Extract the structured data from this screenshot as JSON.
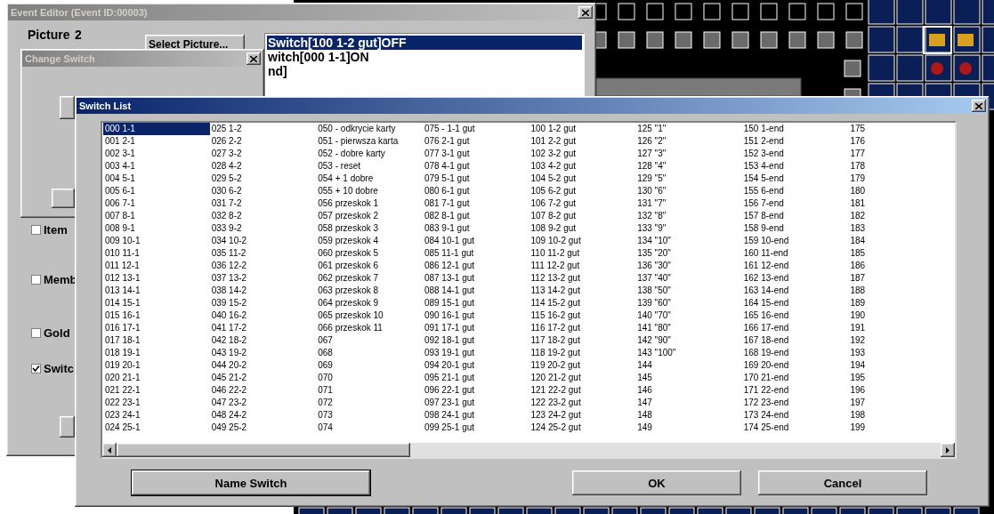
{
  "event_editor": {
    "title": "Event Editor (Event ID:00003)",
    "picture_label": "Picture",
    "picture_value": "2",
    "select_picture_button": "Select Picture...",
    "commands": [
      {
        "label": "Switch[100 1-2 gut]OFF",
        "selected": true
      },
      {
        "label": "witch[000 1-1]ON",
        "selected": false
      },
      {
        "label": "nd]",
        "selected": false
      }
    ],
    "checkboxes": [
      {
        "label": "Item",
        "checked": false
      },
      {
        "label": "Memb",
        "checked": false
      },
      {
        "label": "Gold",
        "checked": false
      },
      {
        "label": "Switc",
        "checked": true
      }
    ]
  },
  "change_switch": {
    "title": "Change Switch"
  },
  "switch_list": {
    "title": "Switch List",
    "columns": [
      {
        "items": [
          {
            "label": "000 1-1",
            "selected": true
          },
          {
            "label": "001 2-1",
            "selected": false
          },
          {
            "label": "002 3-1",
            "selected": false
          },
          {
            "label": "003 4-1",
            "selected": false
          },
          {
            "label": "004 5-1",
            "selected": false
          },
          {
            "label": "005 6-1",
            "selected": false
          },
          {
            "label": "006 7-1",
            "selected": false
          },
          {
            "label": "007 8-1",
            "selected": false
          },
          {
            "label": "008 9-1",
            "selected": false
          },
          {
            "label": "009 10-1",
            "selected": false
          },
          {
            "label": "010 11-1",
            "selected": false
          },
          {
            "label": "011 12-1",
            "selected": false
          },
          {
            "label": "012 13-1",
            "selected": false
          },
          {
            "label": "013 14-1",
            "selected": false
          },
          {
            "label": "014 15-1",
            "selected": false
          },
          {
            "label": "015 16-1",
            "selected": false
          },
          {
            "label": "016 17-1",
            "selected": false
          },
          {
            "label": "017 18-1",
            "selected": false
          },
          {
            "label": "018 19-1",
            "selected": false
          },
          {
            "label": "019 20-1",
            "selected": false
          },
          {
            "label": "020 21-1",
            "selected": false
          },
          {
            "label": "021 22-1",
            "selected": false
          },
          {
            "label": "022 23-1",
            "selected": false
          },
          {
            "label": "023 24-1",
            "selected": false
          },
          {
            "label": "024 25-1",
            "selected": false
          }
        ]
      },
      {
        "items": [
          {
            "label": "025 1-2",
            "selected": false
          },
          {
            "label": "026 2-2",
            "selected": false
          },
          {
            "label": "027 3-2",
            "selected": false
          },
          {
            "label": "028 4-2",
            "selected": false
          },
          {
            "label": "029 5-2",
            "selected": false
          },
          {
            "label": "030 6-2",
            "selected": false
          },
          {
            "label": "031 7-2",
            "selected": false
          },
          {
            "label": "032 8-2",
            "selected": false
          },
          {
            "label": "033 9-2",
            "selected": false
          },
          {
            "label": "034 10-2",
            "selected": false
          },
          {
            "label": "035 11-2",
            "selected": false
          },
          {
            "label": "036 12-2",
            "selected": false
          },
          {
            "label": "037 13-2",
            "selected": false
          },
          {
            "label": "038 14-2",
            "selected": false
          },
          {
            "label": "039 15-2",
            "selected": false
          },
          {
            "label": "040 16-2",
            "selected": false
          },
          {
            "label": "041 17-2",
            "selected": false
          },
          {
            "label": "042 18-2",
            "selected": false
          },
          {
            "label": "043 19-2",
            "selected": false
          },
          {
            "label": "044 20-2",
            "selected": false
          },
          {
            "label": "045 21-2",
            "selected": false
          },
          {
            "label": "046 22-2",
            "selected": false
          },
          {
            "label": "047 23-2",
            "selected": false
          },
          {
            "label": "048 24-2",
            "selected": false
          },
          {
            "label": "049 25-2",
            "selected": false
          }
        ]
      },
      {
        "items": [
          {
            "label": "050 - odkrycie karty",
            "selected": false
          },
          {
            "label": "051 - pierwsza karta",
            "selected": false
          },
          {
            "label": "052 - dobre karty",
            "selected": false
          },
          {
            "label": "053 - reset",
            "selected": false
          },
          {
            "label": "054 + 1 dobre",
            "selected": false
          },
          {
            "label": "055 + 10 dobre",
            "selected": false
          },
          {
            "label": "056 przeskok 1",
            "selected": false
          },
          {
            "label": "057 przeskok 2",
            "selected": false
          },
          {
            "label": "058 przeskok 3",
            "selected": false
          },
          {
            "label": "059 przeskok 4",
            "selected": false
          },
          {
            "label": "060 przeskok 5",
            "selected": false
          },
          {
            "label": "061 przeskok 6",
            "selected": false
          },
          {
            "label": "062 przeskok 7",
            "selected": false
          },
          {
            "label": "063 przeskok 8",
            "selected": false
          },
          {
            "label": "064 przeskok 9",
            "selected": false
          },
          {
            "label": "065 przeskok 10",
            "selected": false
          },
          {
            "label": "066 przeskok 11",
            "selected": false
          },
          {
            "label": "067",
            "selected": false
          },
          {
            "label": "068",
            "selected": false
          },
          {
            "label": "069",
            "selected": false
          },
          {
            "label": "070",
            "selected": false
          },
          {
            "label": "071",
            "selected": false
          },
          {
            "label": "072",
            "selected": false
          },
          {
            "label": "073",
            "selected": false
          },
          {
            "label": "074",
            "selected": false
          }
        ]
      },
      {
        "items": [
          {
            "label": "075 - 1-1 gut",
            "selected": false
          },
          {
            "label": "076 2-1 gut",
            "selected": false
          },
          {
            "label": "077 3-1 gut",
            "selected": false
          },
          {
            "label": "078 4-1 gut",
            "selected": false
          },
          {
            "label": "079 5-1 gut",
            "selected": false
          },
          {
            "label": "080 6-1 gut",
            "selected": false
          },
          {
            "label": "081 7-1 gut",
            "selected": false
          },
          {
            "label": "082 8-1 gut",
            "selected": false
          },
          {
            "label": "083 9-1 gut",
            "selected": false
          },
          {
            "label": "084 10-1 gut",
            "selected": false
          },
          {
            "label": "085 11-1 gut",
            "selected": false
          },
          {
            "label": "086 12-1 gut",
            "selected": false
          },
          {
            "label": "087 13-1 gut",
            "selected": false
          },
          {
            "label": "088 14-1 gut",
            "selected": false
          },
          {
            "label": "089 15-1 gut",
            "selected": false
          },
          {
            "label": "090 16-1 gut",
            "selected": false
          },
          {
            "label": "091 17-1 gut",
            "selected": false
          },
          {
            "label": "092 18-1 gut",
            "selected": false
          },
          {
            "label": "093 19-1 gut",
            "selected": false
          },
          {
            "label": "094 20-1 gut",
            "selected": false
          },
          {
            "label": "095 21-1 gut",
            "selected": false
          },
          {
            "label": "096 22-1 gut",
            "selected": false
          },
          {
            "label": "097 23-1 gut",
            "selected": false
          },
          {
            "label": "098 24-1 gut",
            "selected": false
          },
          {
            "label": "099 25-1 gut",
            "selected": false
          }
        ]
      },
      {
        "items": [
          {
            "label": "100 1-2 gut",
            "selected": false
          },
          {
            "label": "101 2-2 gut",
            "selected": false
          },
          {
            "label": "102 3-2 gut",
            "selected": false
          },
          {
            "label": "103 4-2 gut",
            "selected": false
          },
          {
            "label": "104 5-2 gut",
            "selected": false
          },
          {
            "label": "105 6-2 gut",
            "selected": false
          },
          {
            "label": "106 7-2 gut",
            "selected": false
          },
          {
            "label": "107 8-2 gut",
            "selected": false
          },
          {
            "label": "108 9-2 gut",
            "selected": false
          },
          {
            "label": "109 10-2 gut",
            "selected": false
          },
          {
            "label": "110 11-2 gut",
            "selected": false
          },
          {
            "label": "111 12-2 gut",
            "selected": false
          },
          {
            "label": "112 13-2 gut",
            "selected": false
          },
          {
            "label": "113 14-2 gut",
            "selected": false
          },
          {
            "label": "114 15-2 gut",
            "selected": false
          },
          {
            "label": "115 16-2 gut",
            "selected": false
          },
          {
            "label": "116 17-2 gut",
            "selected": false
          },
          {
            "label": "117 18-2 gut",
            "selected": false
          },
          {
            "label": "118 19-2 gut",
            "selected": false
          },
          {
            "label": "119 20-2 gut",
            "selected": false
          },
          {
            "label": "120 21-2 gut",
            "selected": false
          },
          {
            "label": "121 22-2 gut",
            "selected": false
          },
          {
            "label": "122 23-2 gut",
            "selected": false
          },
          {
            "label": "123 24-2 gut",
            "selected": false
          },
          {
            "label": "124 25-2 gut",
            "selected": false
          }
        ]
      },
      {
        "items": [
          {
            "label": "125 \"1\"",
            "selected": false
          },
          {
            "label": "126 \"2\"",
            "selected": false
          },
          {
            "label": "127 \"3\"",
            "selected": false
          },
          {
            "label": "128 \"4\"",
            "selected": false
          },
          {
            "label": "129 \"5\"",
            "selected": false
          },
          {
            "label": "130 \"6\"",
            "selected": false
          },
          {
            "label": "131 \"7\"",
            "selected": false
          },
          {
            "label": "132 \"8\"",
            "selected": false
          },
          {
            "label": "133 \"9\"",
            "selected": false
          },
          {
            "label": "134 \"10\"",
            "selected": false
          },
          {
            "label": "135 \"20\"",
            "selected": false
          },
          {
            "label": "136 \"30\"",
            "selected": false
          },
          {
            "label": "137 \"40\"",
            "selected": false
          },
          {
            "label": "138 \"50\"",
            "selected": false
          },
          {
            "label": "139 \"60\"",
            "selected": false
          },
          {
            "label": "140 \"70\"",
            "selected": false
          },
          {
            "label": "141 \"80\"",
            "selected": false
          },
          {
            "label": "142 \"90\"",
            "selected": false
          },
          {
            "label": "143 \"100\"",
            "selected": false
          },
          {
            "label": "144",
            "selected": false
          },
          {
            "label": "145",
            "selected": false
          },
          {
            "label": "146",
            "selected": false
          },
          {
            "label": "147",
            "selected": false
          },
          {
            "label": "148",
            "selected": false
          },
          {
            "label": "149",
            "selected": false
          }
        ]
      },
      {
        "items": [
          {
            "label": "150 1-end",
            "selected": false
          },
          {
            "label": "151 2-end",
            "selected": false
          },
          {
            "label": "152 3-end",
            "selected": false
          },
          {
            "label": "153 4-end",
            "selected": false
          },
          {
            "label": "154 5-end",
            "selected": false
          },
          {
            "label": "155 6-end",
            "selected": false
          },
          {
            "label": "156 7-end",
            "selected": false
          },
          {
            "label": "157 8-end",
            "selected": false
          },
          {
            "label": "158 9-end",
            "selected": false
          },
          {
            "label": "159 10-end",
            "selected": false
          },
          {
            "label": "160 11-end",
            "selected": false
          },
          {
            "label": "161 12-end",
            "selected": false
          },
          {
            "label": "162 13-end",
            "selected": false
          },
          {
            "label": "163 14-end",
            "selected": false
          },
          {
            "label": "164 15-end",
            "selected": false
          },
          {
            "label": "165 16-end",
            "selected": false
          },
          {
            "label": "166 17-end",
            "selected": false
          },
          {
            "label": "167 18-end",
            "selected": false
          },
          {
            "label": "168 19-end",
            "selected": false
          },
          {
            "label": "169 20-end",
            "selected": false
          },
          {
            "label": "170 21-end",
            "selected": false
          },
          {
            "label": "171 22-end",
            "selected": false
          },
          {
            "label": "172 23-end",
            "selected": false
          },
          {
            "label": "173 24-end",
            "selected": false
          },
          {
            "label": "174 25-end",
            "selected": false
          }
        ]
      },
      {
        "items": [
          {
            "label": "175",
            "selected": false
          },
          {
            "label": "176",
            "selected": false
          },
          {
            "label": "177",
            "selected": false
          },
          {
            "label": "178",
            "selected": false
          },
          {
            "label": "179",
            "selected": false
          },
          {
            "label": "180",
            "selected": false
          },
          {
            "label": "181",
            "selected": false
          },
          {
            "label": "182",
            "selected": false
          },
          {
            "label": "183",
            "selected": false
          },
          {
            "label": "184",
            "selected": false
          },
          {
            "label": "185",
            "selected": false
          },
          {
            "label": "186",
            "selected": false
          },
          {
            "label": "187",
            "selected": false
          },
          {
            "label": "188",
            "selected": false
          },
          {
            "label": "189",
            "selected": false
          },
          {
            "label": "190",
            "selected": false
          },
          {
            "label": "191",
            "selected": false
          },
          {
            "label": "192",
            "selected": false
          },
          {
            "label": "193",
            "selected": false
          },
          {
            "label": "194",
            "selected": false
          },
          {
            "label": "195",
            "selected": false
          },
          {
            "label": "196",
            "selected": false
          },
          {
            "label": "197",
            "selected": false
          },
          {
            "label": "198",
            "selected": false
          },
          {
            "label": "199",
            "selected": false
          }
        ]
      }
    ],
    "buttons": [
      {
        "label": "Name Switch",
        "kind": "default"
      },
      {
        "label": "OK",
        "kind": "normal"
      },
      {
        "label": "Cancel",
        "kind": "normal"
      }
    ]
  }
}
